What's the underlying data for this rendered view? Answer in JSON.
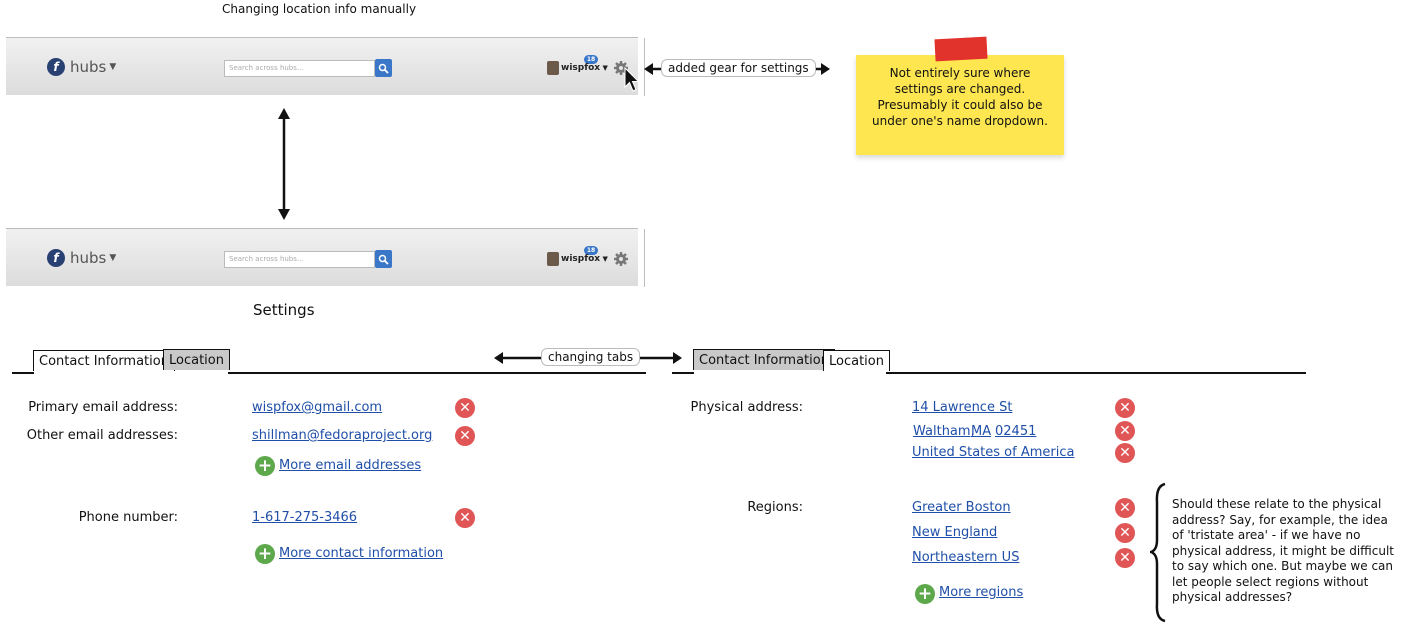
{
  "page_title": "Changing location info manually",
  "header": {
    "app_name": "hubs",
    "logo_letter": "f",
    "search_placeholder": "Search across hubs...",
    "username": "wispfox",
    "notification_count": "18"
  },
  "annotations": {
    "gear_label": "added gear for settings",
    "tabs_label": "changing tabs",
    "sticky_note": "Not entirely sure where settings are changed. Presumably it could also be under one's name dropdown.",
    "regions_comment": "Should these relate to the physical address? Say, for example, the idea of 'tristate area' - if we have no physical address, it might be difficult to say which one. But maybe we can let people select regions without physical addresses?"
  },
  "settings": {
    "heading": "Settings",
    "tabs": [
      "Contact Information",
      "Location"
    ]
  },
  "contact": {
    "primary_email_label": "Primary email address:",
    "primary_email": "wispfox@gmail.com",
    "other_email_label": "Other email addresses:",
    "other_email": "shillman@fedoraproject.org",
    "more_emails": "More email addresses",
    "phone_label": "Phone number:",
    "phone": "1-617-275-3466",
    "more_contact": "More contact information"
  },
  "location": {
    "address_label": "Physical address:",
    "street": "14 Lawrence St",
    "city": "Waltham,",
    "state": "MA",
    "zip": "02451",
    "country": "United States of America",
    "regions_label": "Regions:",
    "regions": [
      "Greater Boston",
      "New England",
      "Northeastern US"
    ],
    "more_regions": "More regions"
  },
  "colors": {
    "accent": "#3b77c8",
    "link": "#1f4fa8",
    "delete": "#e05555",
    "add": "#5da84b",
    "sticky": "#fde64f"
  },
  "icons": [
    "search-icon",
    "gear-icon",
    "chevron-down-icon",
    "delete-icon",
    "add-icon",
    "cursor-icon"
  ]
}
